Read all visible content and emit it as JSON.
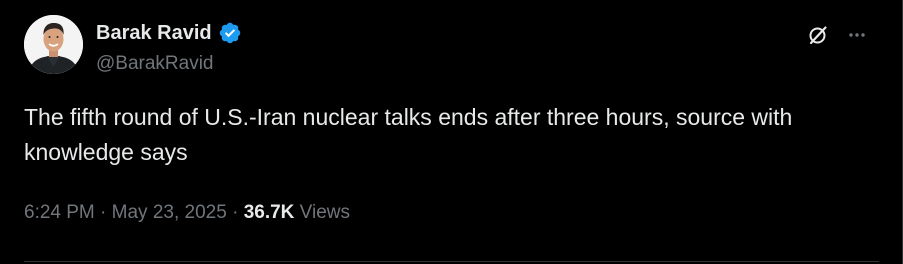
{
  "author": {
    "display_name": "Barak Ravid",
    "handle": "@BarakRavid",
    "verified": true,
    "avatar_icon": "profile-photo"
  },
  "tweet": {
    "text": "The fifth round of U.S.-Iran nuclear talks ends after three hours, source with knowledge says",
    "time": "6:24 PM",
    "separator": "·",
    "date": "May 23, 2025",
    "views_count": "36.7K",
    "views_label": "Views"
  },
  "actions": {
    "grok_icon": "grok-icon",
    "more_icon": "more-dots-icon"
  },
  "colors": {
    "background": "#000000",
    "primary_text": "#e7e9ea",
    "secondary_text": "#71767b",
    "verified_badge": "#1d9bf0",
    "divider": "#2f3336"
  }
}
